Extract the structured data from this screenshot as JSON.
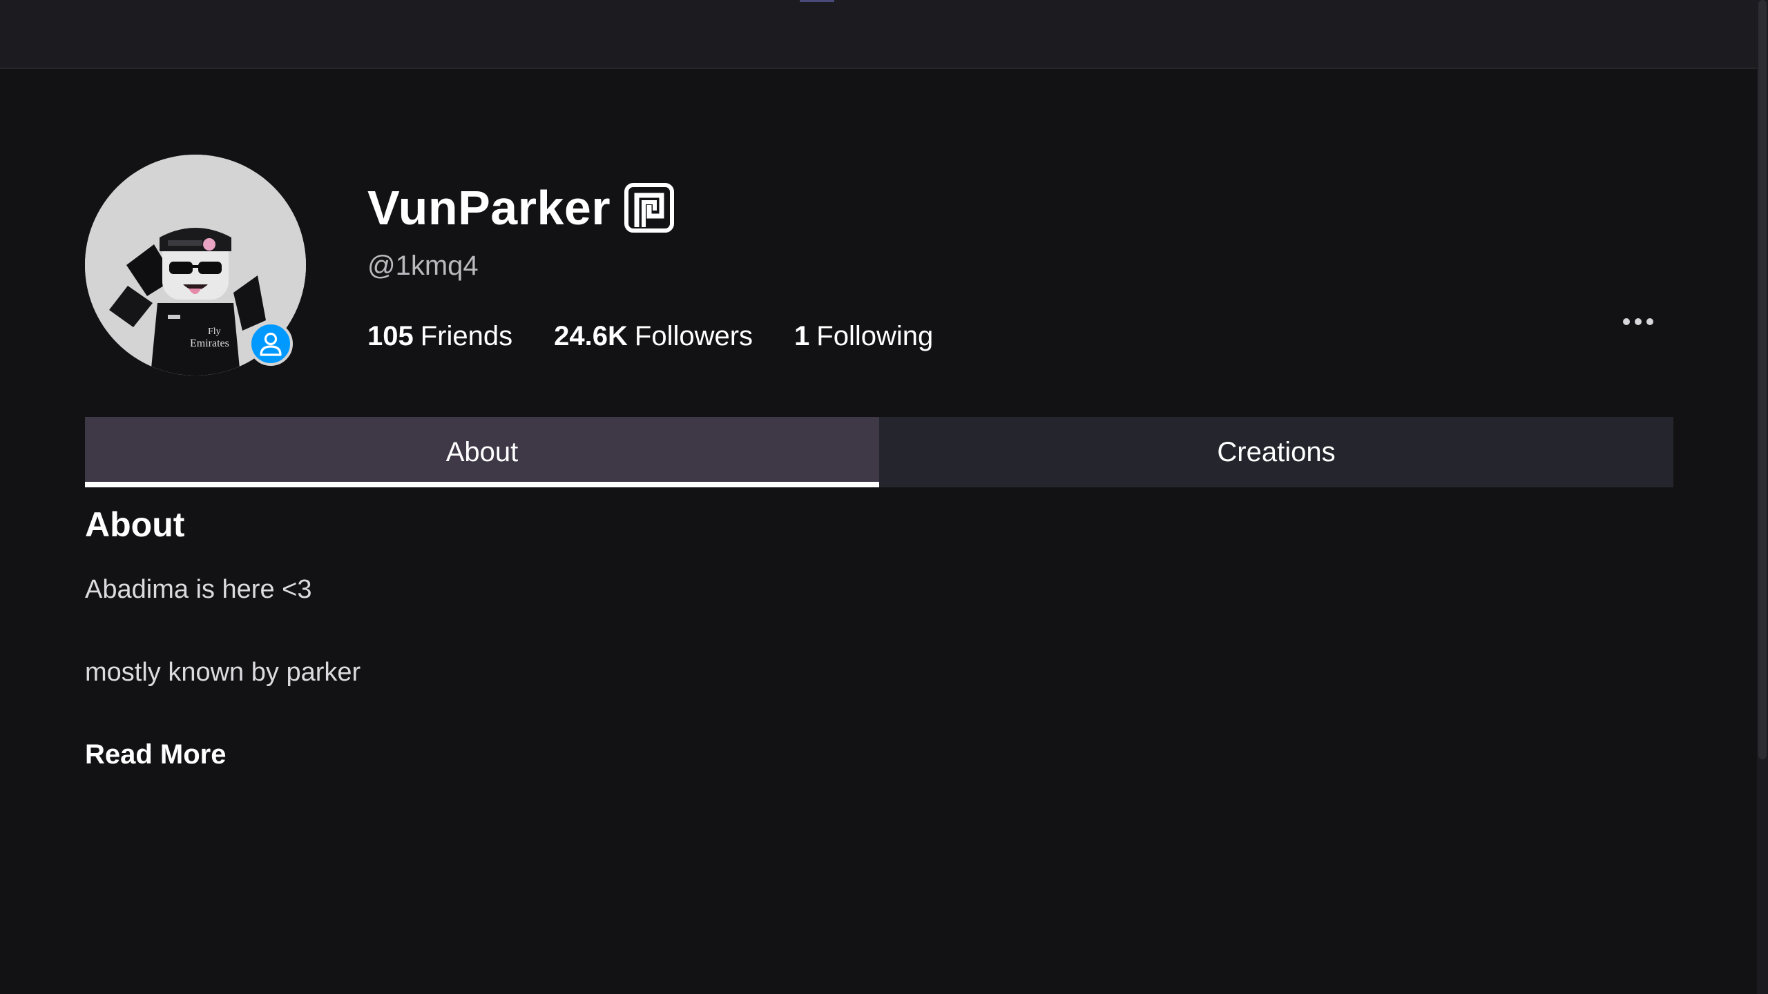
{
  "profile": {
    "display_name": "VunParker",
    "username": "@1kmq4",
    "verified_icon": "verified-badge-icon",
    "avatar_icon": "avatar-image",
    "presence_icon": "online-user-icon"
  },
  "stats": {
    "friends_count": "105",
    "friends_label": "Friends",
    "followers_count": "24.6K",
    "followers_label": "Followers",
    "following_count": "1",
    "following_label": "Following"
  },
  "more_menu_icon": "more-horizontal-icon",
  "tabs": [
    {
      "label": "About",
      "active": true
    },
    {
      "label": "Creations",
      "active": false
    }
  ],
  "about": {
    "heading": "About",
    "lines": [
      "Abadima is here <3",
      "mostly known by parker"
    ],
    "read_more": "Read More"
  },
  "colors": {
    "background": "#121215",
    "topbar": "#1b1b20",
    "active_tab": "#3f3847",
    "inactive_tab": "#25262d",
    "presence_badge": "#0099ff"
  }
}
